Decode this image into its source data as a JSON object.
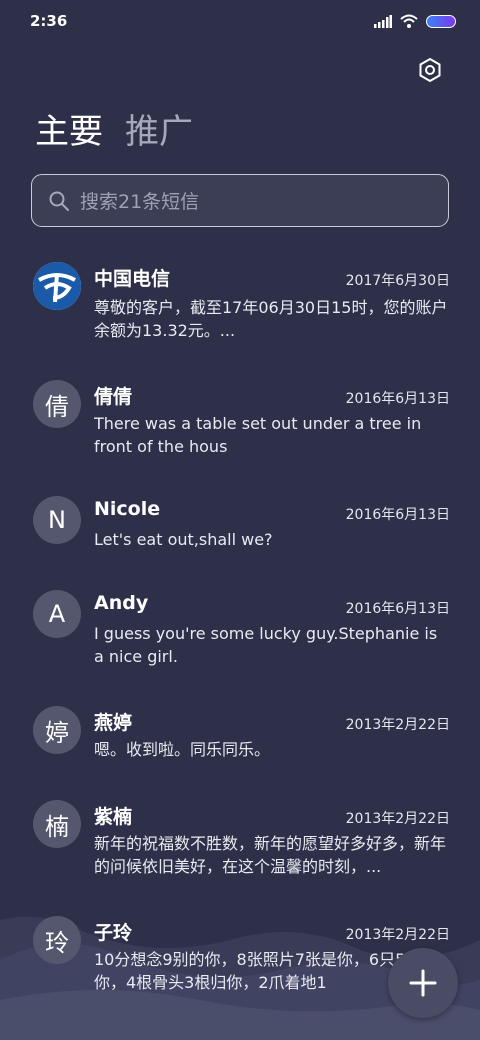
{
  "status": {
    "time": "2:36"
  },
  "tabs": [
    {
      "label": "主要",
      "active": true
    },
    {
      "label": "推广",
      "active": false
    }
  ],
  "search": {
    "placeholder": "搜索21条短信"
  },
  "messages": [
    {
      "name": "中国电信",
      "date": "2017年6月30日",
      "preview": "尊敬的客户，截至17年06月30日15时，您的账户余额为13.32元。...",
      "avatar": "",
      "avatar_icon": "china-telecom-logo-icon"
    },
    {
      "name": "倩倩",
      "date": "2016年6月13日",
      "preview": "There was a table set out under a tree in front of the hous",
      "avatar": "倩"
    },
    {
      "name": "Nicole",
      "date": "2016年6月13日",
      "preview": "Let's eat out,shall we?",
      "avatar": "N"
    },
    {
      "name": "Andy",
      "date": "2016年6月13日",
      "preview": "I guess you're some lucky guy.Stephanie is a nice girl.",
      "avatar": "A"
    },
    {
      "name": "燕婷",
      "date": "2013年2月22日",
      "preview": "嗯。收到啦。同乐同乐。",
      "avatar": "婷"
    },
    {
      "name": "紫楠",
      "date": "2013年2月22日",
      "preview": "新年的祝福数不胜数，新年的愿望好多好多，新年的问候依旧美好，在这个温馨的时刻，...",
      "avatar": "楠"
    },
    {
      "name": "子玲",
      "date": "2013年2月22日",
      "preview": "10分想念9别的你，8张照片7张是你，6只5只像你，4根骨头3根归你，2爪着地1",
      "avatar": "玲"
    }
  ],
  "icons": {
    "settings": "hexagon-settings-icon",
    "search": "search-icon",
    "compose": "plus-icon",
    "signal": "signal-icon",
    "wifi": "wifi-icon",
    "battery": "battery-icon"
  },
  "colors": {
    "background": "#2e3049",
    "avatar": "#55576e",
    "telecom_blue": "#1a5aa8"
  }
}
